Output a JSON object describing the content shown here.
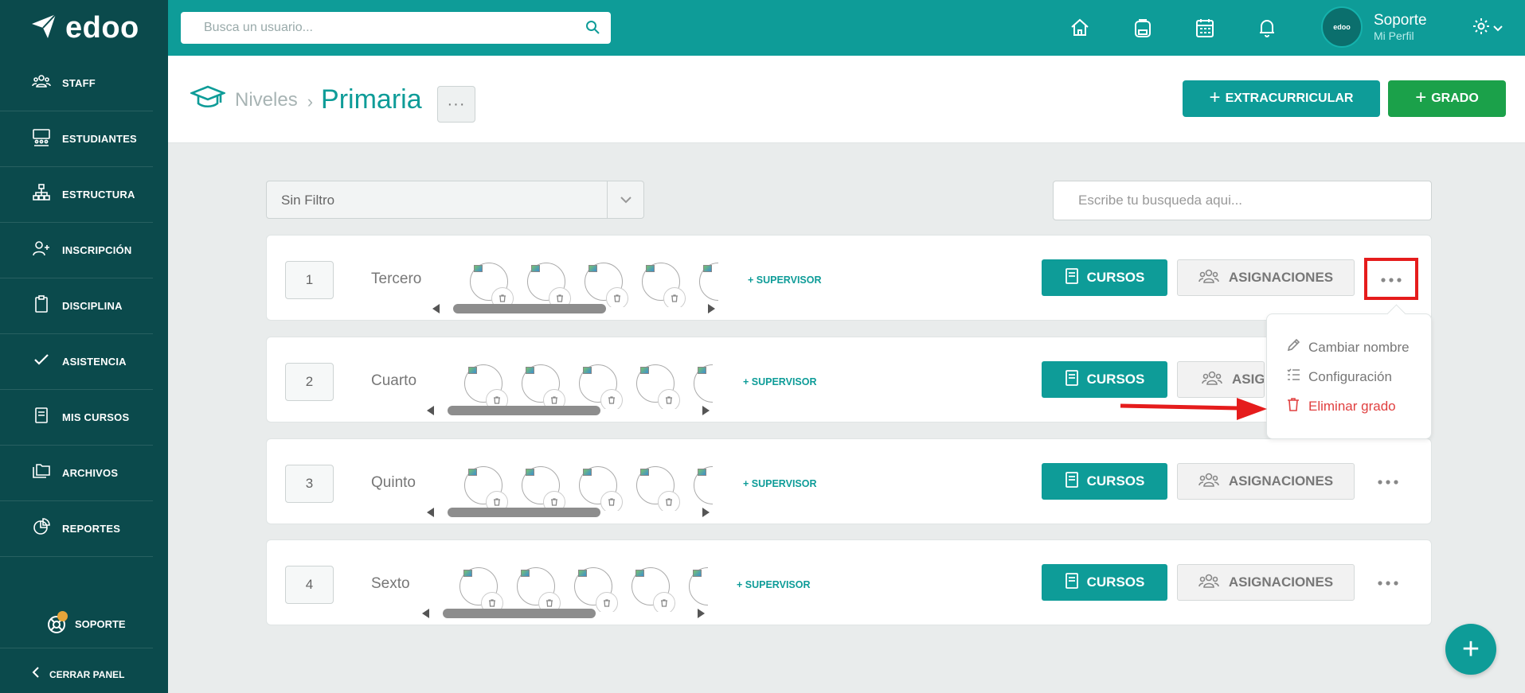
{
  "app": {
    "brand": "edoo"
  },
  "topbar": {
    "search_placeholder": "Busca un usuario...",
    "icons": [
      "home-icon",
      "backpack-icon",
      "calendar-icon",
      "bell-icon"
    ],
    "profile": {
      "avatar_text": "edoo",
      "name": "Soporte",
      "subtitle": "Mi Perfil"
    }
  },
  "sidebar": {
    "items": [
      {
        "label": "STAFF",
        "icon": "staff-icon"
      },
      {
        "label": "ESTUDIANTES",
        "icon": "students-icon"
      },
      {
        "label": "ESTRUCTURA",
        "icon": "structure-icon"
      },
      {
        "label": "INSCRIPCIÓN",
        "icon": "add-user-icon"
      },
      {
        "label": "DISCIPLINA",
        "icon": "clipboard-icon"
      },
      {
        "label": "ASISTENCIA",
        "icon": "check-icon"
      },
      {
        "label": "MIS CURSOS",
        "icon": "book-icon"
      },
      {
        "label": "ARCHIVOS",
        "icon": "folders-icon"
      },
      {
        "label": "REPORTES",
        "icon": "pie-chart-icon"
      }
    ],
    "support_label": "SOPORTE",
    "close_label": "CERRAR PANEL"
  },
  "header": {
    "breadcrumb_parent": "Niveles",
    "breadcrumb_sep": "›",
    "title": "Primaria",
    "more_label": "···",
    "extracurricular_label": "EXTRACURRICULAR",
    "grado_label": "GRADO",
    "plus": "+"
  },
  "filters": {
    "filter_value": "Sin Filtro",
    "search_placeholder": "Escribe tu busqueda aqui..."
  },
  "grades": [
    {
      "number": "1",
      "name": "Tercero"
    },
    {
      "number": "2",
      "name": "Cuarto"
    },
    {
      "number": "3",
      "name": "Quinto"
    },
    {
      "number": "4",
      "name": "Sexto"
    }
  ],
  "grade_actions": {
    "supervisor_label": "+ SUPERVISOR",
    "cursos_label": "CURSOS",
    "asignaciones_label": "ASIGNACIONES"
  },
  "dropdown": {
    "items": [
      {
        "label": "Cambiar nombre",
        "icon": "pencil-icon"
      },
      {
        "label": "Configuración",
        "icon": "list-settings-icon"
      },
      {
        "label": "Eliminar grado",
        "icon": "trash-icon"
      }
    ]
  },
  "fab_label": "+",
  "colors": {
    "sidebar": "#0b4a4c",
    "primary": "#0e9c98",
    "success": "#1ba14a",
    "danger": "#e04040",
    "highlight": "#e51c1c"
  }
}
